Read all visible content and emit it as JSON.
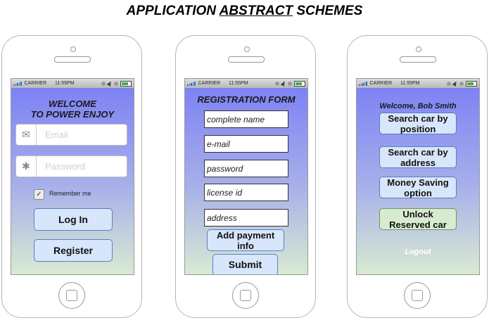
{
  "title": {
    "pre": "APPLICATION ",
    "underlined": "ABSTRACT",
    "post": " SCHEMES"
  },
  "status_bar": {
    "carrier": "CARRIER",
    "time": "11:55PM"
  },
  "login": {
    "welcome_line1": "WELCOME",
    "welcome_line2": "TO POWER ENJOY",
    "email_placeholder": "Email",
    "password_placeholder": "Password",
    "remember_label": "Remember me",
    "remember_checked": true,
    "login_label": "Log In",
    "register_label": "Register"
  },
  "registration": {
    "title": "REGISTRATION FORM",
    "fields": [
      "complete name",
      "e-mail",
      "password",
      "license id",
      "address"
    ],
    "add_payment_label_1": "Add payment",
    "add_payment_label_2": "info",
    "submit_label": "Submit"
  },
  "home": {
    "welcome": "Welcome, Bob Smith",
    "search_position_1": "Search car by",
    "search_position_2": "position",
    "search_address_1": "Search car by",
    "search_address_2": "address",
    "money_saving_1": "Money Saving",
    "money_saving_2": "option",
    "unlock_1": "Unlock",
    "unlock_2": "Reserved car",
    "logout": "Logout"
  },
  "colors": {
    "screen_top": "#7a7ef5",
    "screen_bottom": "#d9ead2",
    "button_blue": "#d7e6fb",
    "button_green": "#d9ead2"
  }
}
